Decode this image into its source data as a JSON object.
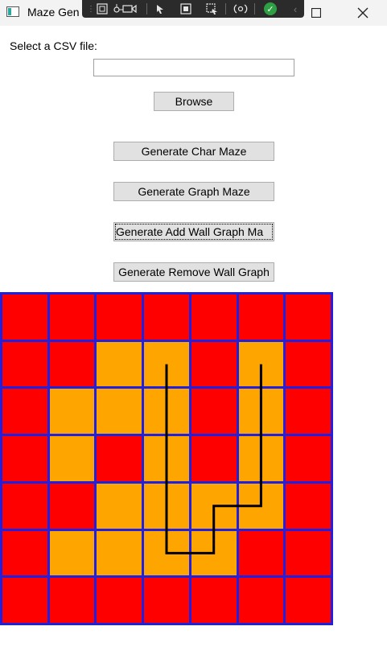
{
  "window": {
    "title": "Maze Gen",
    "minimize_glyph": "—",
    "maximize_glyph": "☐",
    "close_glyph": "✕"
  },
  "toolbar": {
    "icons": [
      "grip-icon",
      "select-element-icon",
      "live-visual-tree-icon",
      "video-icon",
      "pointer-icon",
      "display-layout-adorners-icon",
      "track-focus-icon",
      "hot-reload-icon",
      "binding-failures-icon",
      "collapse-toolbar-icon"
    ]
  },
  "form": {
    "select_label": "Select a CSV file:",
    "file_path": "",
    "browse_label": "Browse",
    "char_maze_label": "Generate Char Maze",
    "graph_maze_label": "Generate Graph Maze",
    "add_wall_label": "Generate Add Wall Graph Ma",
    "remove_wall_label": "Generate Remove Wall Graph"
  },
  "maze": {
    "rows": 7,
    "cols": 7,
    "cells": [
      [
        "wall",
        "wall",
        "wall",
        "wall",
        "wall",
        "wall",
        "wall"
      ],
      [
        "wall",
        "wall",
        "open",
        "open",
        "wall",
        "open",
        "wall"
      ],
      [
        "wall",
        "open",
        "open",
        "open",
        "wall",
        "open",
        "wall"
      ],
      [
        "wall",
        "open",
        "wall",
        "open",
        "wall",
        "open",
        "wall"
      ],
      [
        "wall",
        "wall",
        "open",
        "open",
        "open",
        "open",
        "wall"
      ],
      [
        "wall",
        "open",
        "open",
        "open",
        "open",
        "wall",
        "wall"
      ],
      [
        "wall",
        "wall",
        "wall",
        "wall",
        "wall",
        "wall",
        "wall"
      ]
    ],
    "path_cells": [
      [
        1,
        3
      ],
      [
        2,
        3
      ],
      [
        3,
        3
      ],
      [
        4,
        3
      ],
      [
        5,
        3
      ],
      [
        5,
        4
      ],
      [
        4,
        4
      ],
      [
        4,
        5
      ],
      [
        3,
        5
      ],
      [
        2,
        5
      ],
      [
        1,
        5
      ]
    ],
    "colors": {
      "wall": "#ff0000",
      "open": "#ffa500",
      "grid": "#2020e0",
      "path": "#000000"
    }
  }
}
